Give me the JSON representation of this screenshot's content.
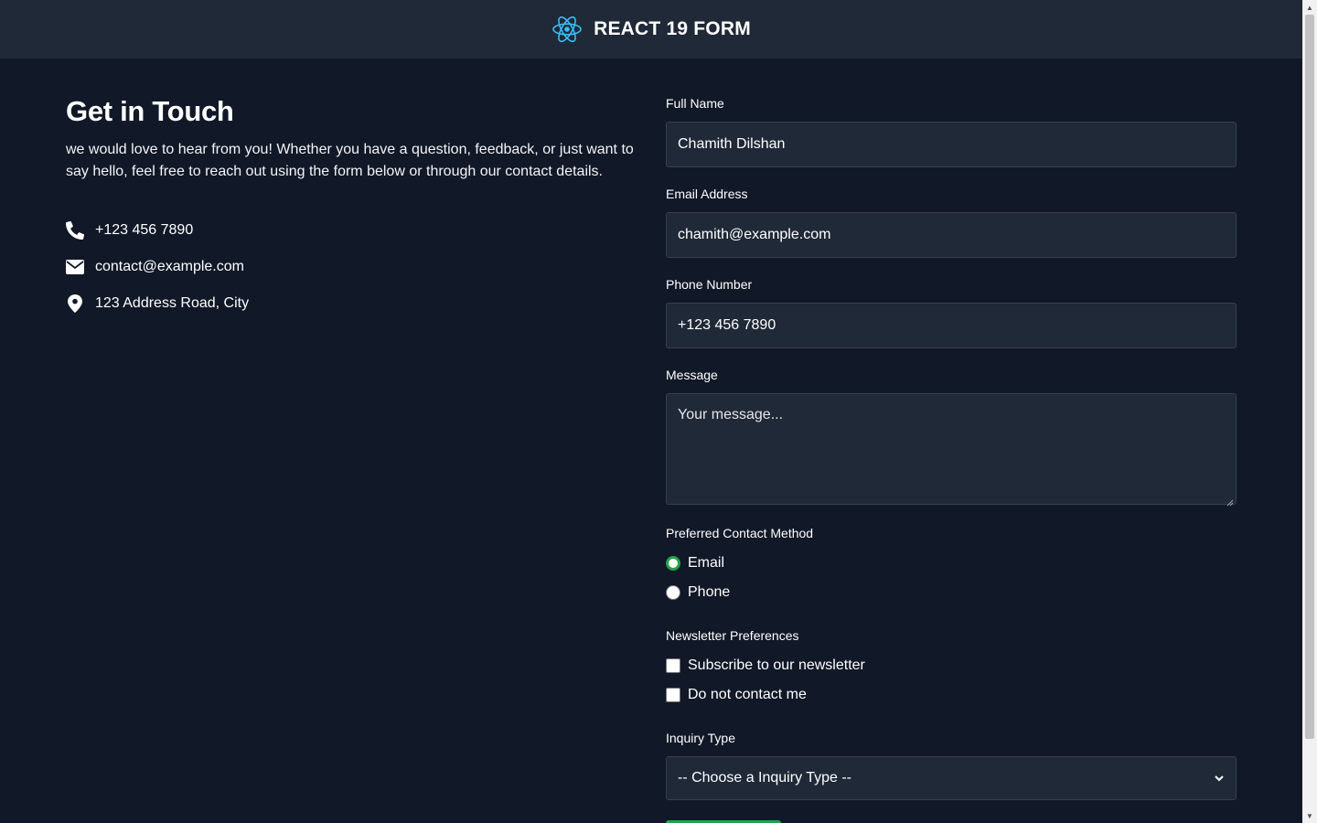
{
  "header": {
    "title": "REACT 19 FORM",
    "logo_icon": "react-atom-icon",
    "logo_color": "#38bdf8"
  },
  "contact": {
    "heading": "Get in Touch",
    "intro": "we would love to hear from you! Whether you have a question, feedback, or just want to say hello, feel free to reach out using the form below or through our contact details.",
    "items": [
      {
        "icon": "phone-icon",
        "text": "+123 456 7890"
      },
      {
        "icon": "envelope-icon",
        "text": "contact@example.com"
      },
      {
        "icon": "map-pin-icon",
        "text": "123 Address Road, City"
      }
    ]
  },
  "form": {
    "full_name": {
      "label": "Full Name",
      "value": "Chamith Dilshan"
    },
    "email": {
      "label": "Email Address",
      "value": "chamith@example.com"
    },
    "phone": {
      "label": "Phone Number",
      "value": "+123 456 7890"
    },
    "message": {
      "label": "Message",
      "placeholder": "Your message..."
    },
    "contact_method": {
      "label": "Preferred Contact Method",
      "options": [
        {
          "label": "Email",
          "checked": true
        },
        {
          "label": "Phone",
          "checked": false
        }
      ]
    },
    "newsletter": {
      "label": "Newsletter Preferences",
      "options": [
        {
          "label": "Subscribe to our newsletter",
          "checked": false
        },
        {
          "label": "Do not contact me",
          "checked": false
        }
      ]
    },
    "inquiry": {
      "label": "Inquiry Type",
      "selected": "-- Choose a Inquiry Type --"
    }
  },
  "colors": {
    "background": "#111827",
    "header_bg": "#1f2937",
    "field_bg": "#1f2937",
    "accent_green": "#22a34a"
  }
}
